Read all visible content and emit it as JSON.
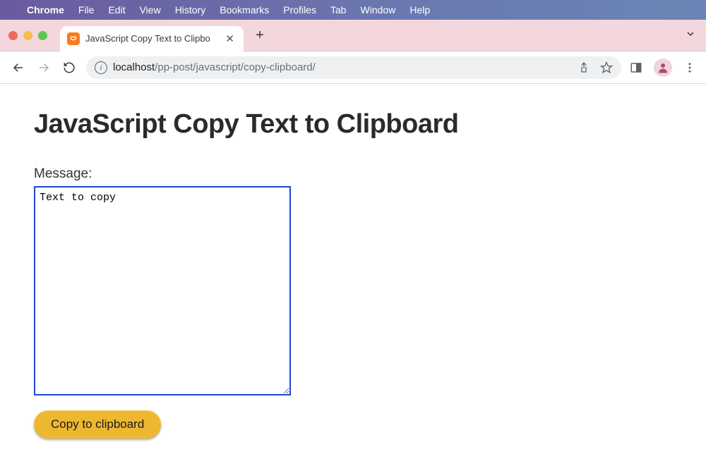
{
  "menubar": {
    "app": "Chrome",
    "items": [
      "File",
      "Edit",
      "View",
      "History",
      "Bookmarks",
      "Profiles",
      "Tab",
      "Window",
      "Help"
    ]
  },
  "tab": {
    "title": "JavaScript Copy Text to Clipbo"
  },
  "address": {
    "host": "localhost",
    "path": "/pp-post/javascript/copy-clipboard/"
  },
  "page": {
    "heading": "JavaScript Copy Text to Clipboard",
    "label": "Message:",
    "textarea_value": "Text to copy",
    "button": "Copy to clipboard"
  }
}
